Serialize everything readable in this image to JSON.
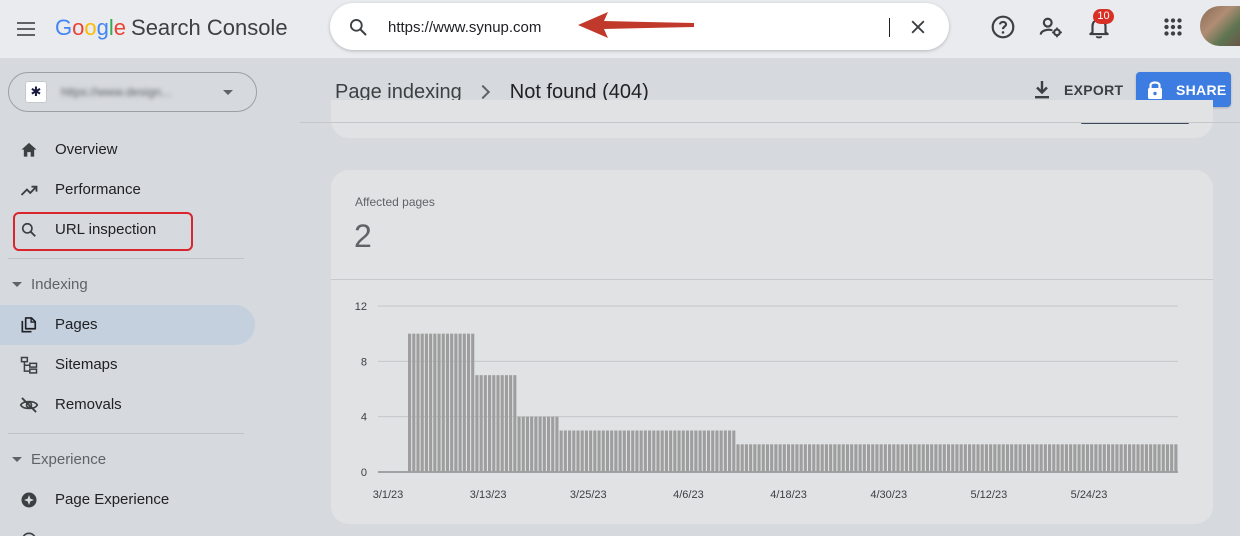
{
  "header": {
    "logo_g1": "G",
    "logo_o1": "o",
    "logo_o2": "o",
    "logo_g2": "g",
    "logo_l": "l",
    "logo_e": "e",
    "product": "Search Console",
    "search_value": "https://www.synup.com",
    "notification_count": "10",
    "icons": [
      "menu-icon",
      "search-icon",
      "close-icon",
      "help-icon",
      "manage-users-icon",
      "bell-icon",
      "apps-grid-icon"
    ]
  },
  "sidebar": {
    "property_url": "https://www.design...",
    "items": [
      {
        "label": "Overview",
        "icon": "home-icon"
      },
      {
        "label": "Performance",
        "icon": "trending-up-icon"
      },
      {
        "label": "URL inspection",
        "icon": "search-icon"
      }
    ],
    "sections": [
      {
        "label": "Indexing",
        "items": [
          {
            "label": "Pages",
            "icon": "pages-icon",
            "active": true
          },
          {
            "label": "Sitemaps",
            "icon": "sitemap-icon"
          },
          {
            "label": "Removals",
            "icon": "visibility-off-icon"
          }
        ]
      },
      {
        "label": "Experience",
        "items": [
          {
            "label": "Page Experience",
            "icon": "page-experience-icon"
          }
        ]
      }
    ]
  },
  "page": {
    "breadcrumb_parent": "Page indexing",
    "breadcrumb_current": "Not found (404)",
    "export_label": "EXPORT",
    "share_label": "SHARE"
  },
  "card": {
    "metric_label": "Affected pages",
    "metric_value": "2"
  },
  "colors": {
    "bar": "#9e9e9e",
    "share_button": "#3d7ce0",
    "highlight_box": "#d9262c",
    "arrow": "#c0392b",
    "active_nav": "#c4d0de"
  },
  "chart_data": {
    "type": "bar",
    "title": "",
    "xlabel": "",
    "ylabel": "",
    "ylim": [
      0,
      12
    ],
    "y_ticks": [
      0,
      4,
      8,
      12
    ],
    "x_tick_labels": [
      "3/1/23",
      "3/13/23",
      "3/25/23",
      "4/6/23",
      "4/18/23",
      "4/30/23",
      "5/12/23",
      "5/24/23"
    ],
    "grid": true,
    "series": [
      {
        "values": [
          0,
          0,
          0,
          0,
          0,
          0,
          0,
          10,
          10,
          10,
          10,
          10,
          10,
          10,
          10,
          10,
          10,
          10,
          10,
          10,
          10,
          10,
          10,
          7,
          7,
          7,
          7,
          7,
          7,
          7,
          7,
          7,
          7,
          4,
          4,
          4,
          4,
          4,
          4,
          4,
          4,
          4,
          4,
          3,
          3,
          3,
          3,
          3,
          3,
          3,
          3,
          3,
          3,
          3,
          3,
          3,
          3,
          3,
          3,
          3,
          3,
          3,
          3,
          3,
          3,
          3,
          3,
          3,
          3,
          3,
          3,
          3,
          3,
          3,
          3,
          3,
          3,
          3,
          3,
          3,
          3,
          3,
          3,
          3,
          3,
          2,
          2,
          2,
          2,
          2,
          2,
          2,
          2,
          2,
          2,
          2,
          2,
          2,
          2,
          2,
          2,
          2,
          2,
          2,
          2,
          2,
          2,
          2,
          2,
          2,
          2,
          2,
          2,
          2,
          2,
          2,
          2,
          2,
          2,
          2,
          2,
          2,
          2,
          2,
          2,
          2,
          2,
          2,
          2,
          2,
          2,
          2,
          2,
          2,
          2,
          2,
          2,
          2,
          2,
          2,
          2,
          2,
          2,
          2,
          2,
          2,
          2,
          2,
          2,
          2,
          2,
          2,
          2,
          2,
          2,
          2,
          2,
          2,
          2,
          2,
          2,
          2,
          2,
          2,
          2,
          2,
          2,
          2,
          2,
          2,
          2,
          2,
          2,
          2,
          2,
          2,
          2,
          2,
          2,
          2,
          2,
          2,
          2,
          2,
          2,
          2,
          2,
          2,
          2,
          2
        ]
      }
    ]
  }
}
